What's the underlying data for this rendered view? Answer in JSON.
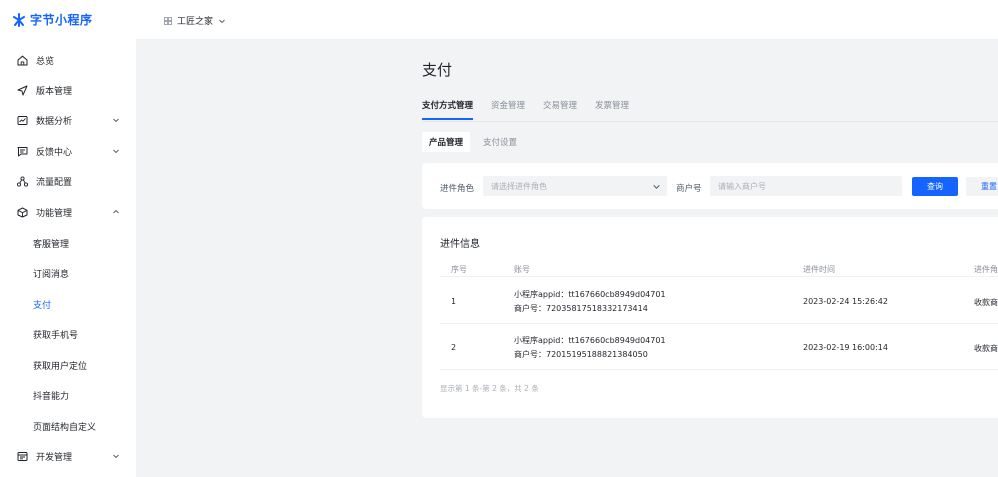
{
  "app": {
    "logo_text": "字节小程序",
    "brand_color": "#1664ff"
  },
  "topbar": {
    "workspace_name": "工匠之家",
    "workspace_icon": "grid-icon"
  },
  "sidebar": {
    "items": [
      {
        "label": "总览",
        "icon": "home-icon",
        "expandable": false
      },
      {
        "label": "版本管理",
        "icon": "send-icon",
        "expandable": false
      },
      {
        "label": "数据分析",
        "icon": "chart-icon",
        "expandable": true,
        "expanded": false
      },
      {
        "label": "反馈中心",
        "icon": "message-icon",
        "expandable": true,
        "expanded": false
      },
      {
        "label": "流量配置",
        "icon": "traffic-icon",
        "expandable": false
      },
      {
        "label": "功能管理",
        "icon": "package-icon",
        "expandable": true,
        "expanded": true
      },
      {
        "label": "开发管理",
        "icon": "code-icon",
        "expandable": true,
        "expanded": false
      }
    ],
    "sub_items": [
      {
        "label": "客服管理",
        "active": false
      },
      {
        "label": "订阅消息",
        "active": false
      },
      {
        "label": "支付",
        "active": true
      },
      {
        "label": "获取手机号",
        "active": false
      },
      {
        "label": "获取用户定位",
        "active": false
      },
      {
        "label": "抖音能力",
        "active": false
      },
      {
        "label": "页面结构自定义",
        "active": false
      }
    ]
  },
  "main": {
    "title": "支付",
    "tabs": [
      {
        "label": "支付方式管理",
        "active": true
      },
      {
        "label": "资金管理",
        "active": false
      },
      {
        "label": "交易管理",
        "active": false
      },
      {
        "label": "发票管理",
        "active": false
      }
    ],
    "subtabs": [
      {
        "label": "产品管理",
        "active": true
      },
      {
        "label": "支付设置",
        "active": false
      }
    ],
    "filter": {
      "role_label": "进件角色",
      "role_placeholder": "请选择进件角色",
      "merchant_label": "商户号",
      "merchant_placeholder": "请输入商户号",
      "query_label": "查询",
      "reset_label": "重置"
    },
    "table": {
      "title": "进件信息",
      "columns": [
        "序号",
        "账号",
        "进件时间",
        "进件角"
      ],
      "rows": [
        {
          "index": "1",
          "account_line1": "小程序appid：tt167660cb8949d04701",
          "account_line2": "商户号：72035817518332173414",
          "time": "2023-02-24 15:26:42",
          "role": "收款商"
        },
        {
          "index": "2",
          "account_line1": "小程序appid：tt167660cb8949d04701",
          "account_line2": "商户号：72015195188821384050",
          "time": "2023-02-19 16:00:14",
          "role": "收款商"
        }
      ],
      "pagination_text": "显示第 1 条-第 2 条，共 2 条"
    }
  }
}
